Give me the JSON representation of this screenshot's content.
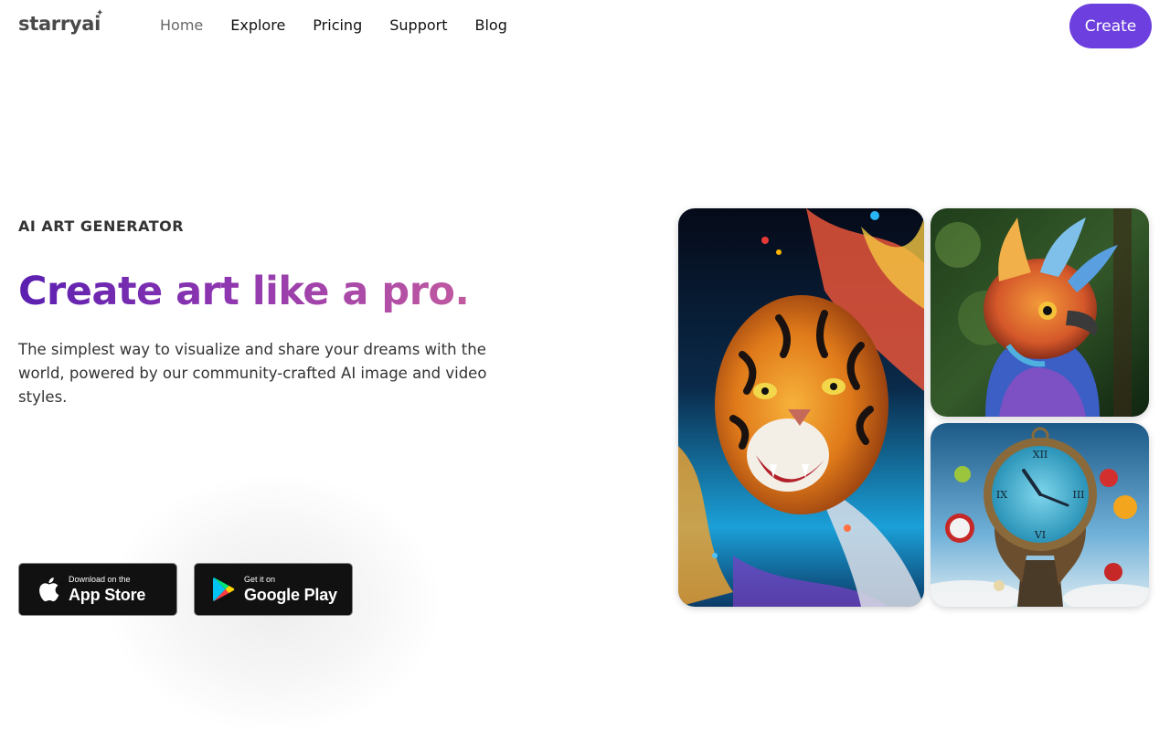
{
  "header": {
    "logo_text": "starryai",
    "nav": [
      "Home",
      "Explore",
      "Pricing",
      "Support",
      "Blog"
    ],
    "active_nav": "Home",
    "create_label": "Create"
  },
  "hero": {
    "eyebrow": "AI ART GENERATOR",
    "headline": "Create art like a pro.",
    "subtext": "The simplest way to visualize and share your dreams with the world, powered by our community-crafted AI image and video styles."
  },
  "badges": {
    "app_store": {
      "small": "Download on the",
      "large": "App Store"
    },
    "google_play": {
      "small": "Get it on",
      "large": "Google Play"
    }
  },
  "gallery": {
    "images": [
      "tiger-artwork",
      "bird-artwork",
      "melting-clock-artwork"
    ]
  },
  "colors": {
    "accent": "#6d3fde",
    "headline_gradient_start": "#5a1fb0",
    "headline_gradient_end": "#c25aa0"
  }
}
